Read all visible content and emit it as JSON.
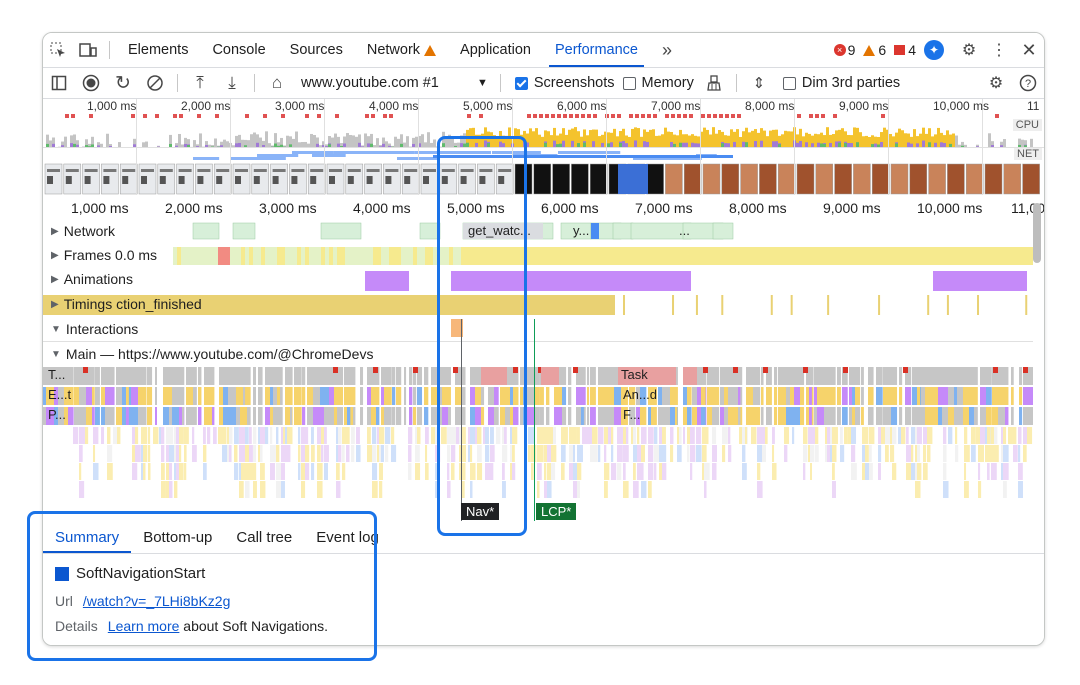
{
  "tabbar": {
    "tabs": [
      "Elements",
      "Console",
      "Sources",
      "Network",
      "Application",
      "Performance"
    ],
    "more": "»",
    "errors": "9",
    "warnings": "6",
    "issues": "4"
  },
  "toolbar": {
    "url": "www.youtube.com #1",
    "screenshots_label": "Screenshots",
    "memory_label": "Memory",
    "dim_label": "Dim 3rd parties"
  },
  "overview": {
    "ticks": [
      "1,000 ms",
      "2,000 ms",
      "3,000 ms",
      "4,000 ms",
      "5,000 ms",
      "6,000 ms",
      "7,000 ms",
      "8,000 ms",
      "9,000 ms",
      "10,000 ms",
      "11"
    ],
    "cpu_label": "CPU",
    "net_label": "NET"
  },
  "timescale": {
    "ticks": [
      "1,000 ms",
      "2,000 ms",
      "3,000 ms",
      "4,000 ms",
      "5,000 ms",
      "6,000 ms",
      "7,000 ms",
      "8,000 ms",
      "9,000 ms",
      "10,000 ms",
      "11,00"
    ]
  },
  "tracks": {
    "network": "Network",
    "network_item1": "get_watc...",
    "network_item2": "y...",
    "network_item3": "...",
    "frames": "Frames",
    "frames_value": "0.0 ms",
    "animations": "Animations",
    "timings": "Timings",
    "timings_value": "ction_finished",
    "interactions": "Interactions",
    "main": "Main — https://www.youtube.com/@ChromeDevs",
    "main_rows": [
      "T...",
      "E...t",
      "P..."
    ],
    "task_label": "Task",
    "and_label": "An...d",
    "f_label": "F...",
    "nav_marker": "Nav*",
    "lcp_marker": "LCP*"
  },
  "lower": {
    "tabs": [
      "Summary",
      "Bottom-up",
      "Call tree",
      "Event log"
    ],
    "title": "SoftNavigationStart",
    "url_label": "Url",
    "url_value": "/watch?v=_7LHi8bKz2g",
    "details_label": "Details",
    "details_link": "Learn more",
    "details_text": "about Soft Navigations."
  }
}
